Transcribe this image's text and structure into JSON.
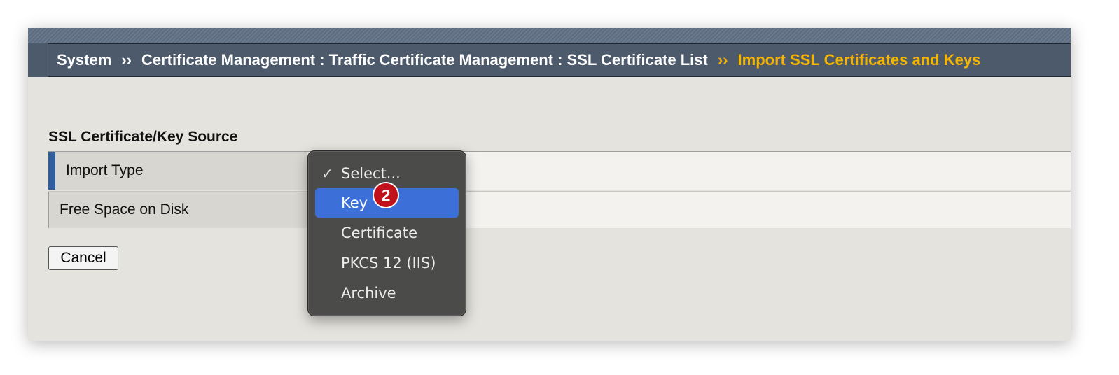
{
  "breadcrumb": {
    "items": [
      "System",
      "Certificate Management : Traffic Certificate Management : SSL Certificate List"
    ],
    "separator": "››",
    "active": "Import SSL Certificates and Keys"
  },
  "section": {
    "title": "SSL Certificate/Key Source"
  },
  "properties": [
    {
      "label": "Import Type",
      "value": ""
    },
    {
      "label": "Free Space on Disk",
      "value": ""
    }
  ],
  "buttons": {
    "cancel": "Cancel"
  },
  "dropdown": {
    "checkmark": "✓",
    "options": [
      "Select...",
      "Key",
      "Certificate",
      "PKCS 12 (IIS)",
      "Archive"
    ],
    "checked_option": "Select...",
    "highlighted_option": "Key"
  },
  "annotation": {
    "step_badge": "2"
  },
  "colors": {
    "header_bg": "#4c5a6c",
    "breadcrumb_active": "#f4b400",
    "row_accent": "#2f5e9d",
    "dropdown_bg": "#4b4b4a",
    "dropdown_highlight": "#3d6fd9",
    "badge": "#c0121a"
  }
}
